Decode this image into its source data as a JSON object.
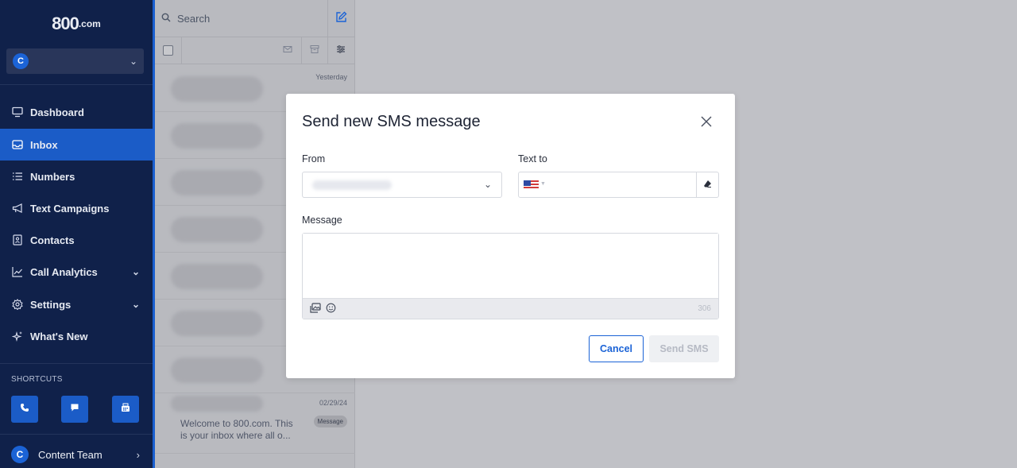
{
  "brand": {
    "logo_main": "800",
    "logo_suffix": ".com"
  },
  "account": {
    "avatar_letter": "C"
  },
  "sidebar": {
    "items": [
      {
        "label": "Dashboard",
        "icon": "monitor-icon"
      },
      {
        "label": "Inbox",
        "icon": "inbox-icon",
        "active": true
      },
      {
        "label": "Numbers",
        "icon": "list-icon"
      },
      {
        "label": "Text Campaigns",
        "icon": "megaphone-icon"
      },
      {
        "label": "Contacts",
        "icon": "contact-card-icon"
      },
      {
        "label": "Call Analytics",
        "icon": "line-chart-icon",
        "expandable": true
      },
      {
        "label": "Settings",
        "icon": "gear-icon",
        "expandable": true
      },
      {
        "label": "What's New",
        "icon": "sparkle-icon"
      }
    ],
    "shortcuts_label": "SHORTCUTS",
    "shortcuts": [
      "phone-icon",
      "chat-icon",
      "fax-icon"
    ],
    "user": {
      "avatar_letter": "C",
      "name": "Content Team"
    }
  },
  "inbox": {
    "search_placeholder": "Search",
    "rows": [
      {
        "date": "Yesterday"
      },
      {},
      {},
      {},
      {},
      {},
      {},
      {
        "date": "02/29/24",
        "badge": "Message",
        "preview": "Welcome to 800.com. This is your inbox where all o..."
      }
    ]
  },
  "modal": {
    "title": "Send new SMS message",
    "from_label": "From",
    "to_label": "Text to",
    "message_label": "Message",
    "char_count": "306",
    "cancel_label": "Cancel",
    "send_label": "Send SMS"
  },
  "colors": {
    "sidebar_bg": "#10214a",
    "accent": "#1b5cc7",
    "overlay": "#c0c1c6"
  }
}
